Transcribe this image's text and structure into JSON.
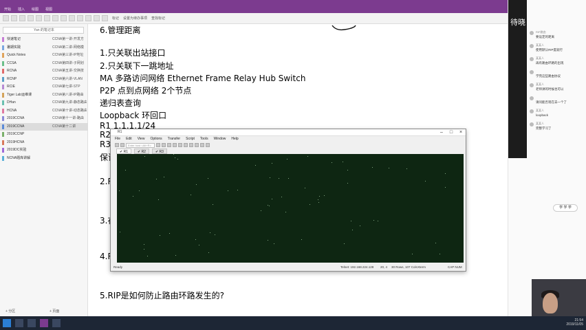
{
  "ribbon": {
    "tabs": [
      "开始",
      "插入",
      "绘图",
      "视图"
    ],
    "actions": [
      "标记",
      "设置为待办事项",
      "查找标记"
    ]
  },
  "sidebar": {
    "search_label": "Yan 的笔记本",
    "sections": [
      {
        "name": "快速笔记",
        "page": "CCNA第一讲-开发方",
        "color": "#c77dd6"
      },
      {
        "name": "暑期实践",
        "page": "CCNA第二讲-网络模",
        "color": "#7aa6e0"
      },
      {
        "name": "Quick Notes",
        "page": "CCNA第三讲-IP地址",
        "color": "#e0a35a"
      },
      {
        "name": "CCSA",
        "page": "CCNA第四讲-子网划",
        "color": "#6bbf8a"
      },
      {
        "name": "RCNA",
        "page": "CCNA第五讲-交换技",
        "color": "#e06a6a"
      },
      {
        "name": "RCNP",
        "page": "CCNA第六讲-VLAN",
        "color": "#5aa0c8"
      },
      {
        "name": "RCIE",
        "page": "CCNA第七讲-STP",
        "color": "#b78bd4"
      },
      {
        "name": "Tiger Lab运维课",
        "page": "CCNA第八讲-IP路由",
        "color": "#d4a35a"
      },
      {
        "name": "DHan",
        "page": "CCNA第九讲-静态路由",
        "color": "#6ac0b0"
      },
      {
        "name": "HCNA",
        "page": "CCNA第十讲-动态路由",
        "color": "#e07aa0"
      },
      {
        "name": "2019CCNA",
        "page": "CCNA第十一讲-路由",
        "color": "#8a8ad8"
      },
      {
        "name": "2019CCNA",
        "page": "CCNA第十二讲",
        "color": "#5a8ad8",
        "selected": true
      },
      {
        "name": "2019CCNP",
        "page": "",
        "color": "#7ab06a"
      },
      {
        "name": "2019HCNA",
        "page": "",
        "color": "#d87a5a"
      },
      {
        "name": "2019DC实验",
        "page": "",
        "color": "#a06ad8"
      },
      {
        "name": "NCNA题库讲解",
        "page": "",
        "color": "#5ab0d8"
      }
    ],
    "footer_left": "+ 分区",
    "footer_right": "+ 页面"
  },
  "notes": {
    "lines": [
      "6.管理距离",
      "1.只关联出站接口",
      "2.只关联下一跳地址",
      "MA 多路访问网络 Ethernet Frame Relay Hub Switch",
      "P2P 点到点网络 2个节点",
      "递归表查询",
      "Loopback 环回口",
      "R1 1.1.1.1/24",
      "R2",
      "R3",
      "保证",
      "2.R",
      "3.在",
      "4.R",
      "5.RIP是如何防止路由环路发生的?"
    ]
  },
  "chat": {
    "logo": "待晓",
    "messages": [
      {
        "name": "RIP路由",
        "text": "要设定的距离"
      },
      {
        "name": "某某人",
        "text": "使用默认RIP度就行"
      },
      {
        "name": "某某人",
        "text": "再有路由环路的出现"
      },
      {
        "name": "",
        "text": "学完这些路由协议"
      },
      {
        "name": "某某人",
        "text": "老师讲的时候也可以"
      },
      {
        "name": "",
        "text": "请问能否现在去一个了"
      },
      {
        "name": "某某人",
        "text": "loopback"
      },
      {
        "name": "某某人",
        "text": "完整学习了"
      }
    ],
    "bubble": "学 学 学"
  },
  "crt": {
    "title": "R1",
    "menu": [
      "File",
      "Edit",
      "View",
      "Options",
      "Transfer",
      "Script",
      "Tools",
      "Window",
      "Help"
    ],
    "address_placeholder": "Enter host <Alt+R>",
    "tabs": [
      {
        "label": "✔ R1",
        "active": true
      },
      {
        "label": "✔ R2",
        "active": false
      },
      {
        "label": "✔ R3",
        "active": false
      }
    ],
    "status": {
      "ready": "Ready",
      "session": "Telnet: 192.168.224.128",
      "pos": "20, 4",
      "size": "30 Rows, 107 Cols",
      "term": "Xterm",
      "caps": "CAP NUM"
    }
  },
  "taskbar": {
    "time": "21:54",
    "date": "2019/11/05"
  }
}
